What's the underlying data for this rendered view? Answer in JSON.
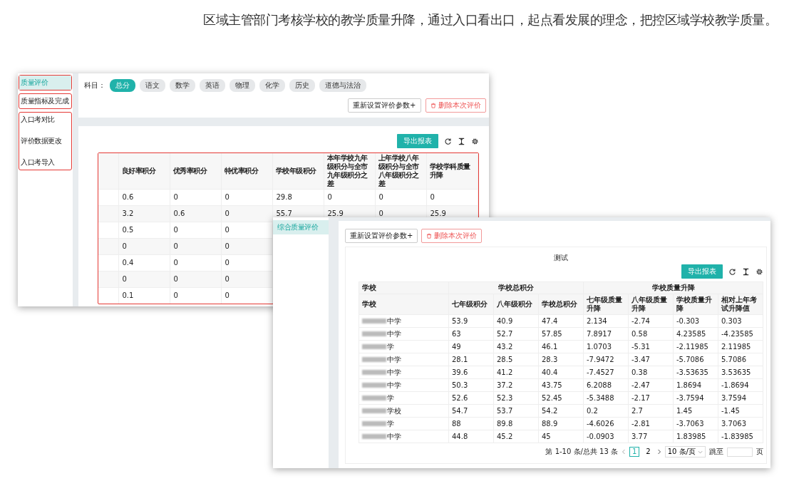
{
  "headline": "区域主管部门考核学校的教学质量升降，通过入口看出口，起点看发展的理念，把控区域学校教学质量。",
  "window_a": {
    "sidebar": {
      "groups": [
        {
          "outlined": true,
          "items": [
            {
              "label": "质量评价",
              "selected": true
            }
          ]
        },
        {
          "outlined": true,
          "items": [
            {
              "label": "质量指标及完成",
              "selected": false
            }
          ]
        },
        {
          "outlined": true,
          "items": [
            {
              "label": "入口考对比",
              "selected": false
            },
            {
              "label": "评价数据更改",
              "selected": false
            },
            {
              "label": "入口考导入",
              "selected": false
            }
          ]
        }
      ]
    },
    "subject_label": "科目：",
    "subjects": [
      {
        "label": "总分",
        "selected": true
      },
      {
        "label": "语文",
        "selected": false
      },
      {
        "label": "数学",
        "selected": false
      },
      {
        "label": "英语",
        "selected": false
      },
      {
        "label": "物理",
        "selected": false
      },
      {
        "label": "化学",
        "selected": false
      },
      {
        "label": "历史",
        "selected": false
      },
      {
        "label": "道德与法治",
        "selected": false
      }
    ],
    "buttons": [
      {
        "kind": "default",
        "label": "重新设置评价参数+"
      },
      {
        "kind": "danger",
        "label": "删除本次评价"
      }
    ],
    "export_button": "导出报表",
    "table": {
      "outlined": true,
      "columns": [
        "良好率积分",
        "优秀率积分",
        "特优率积分",
        "学校年级积分",
        "本年学校九年级积分与全市九年级积分之差",
        "上年学校八年级积分与全市八年级积分之差",
        "学校学科质量升降"
      ],
      "rows": [
        {
          "cells": [
            "0.6",
            "0",
            "0",
            "29.8",
            "0",
            "0",
            "0"
          ]
        },
        {
          "cells": [
            "3.2",
            "0.6",
            "0",
            "55.7",
            "25.9",
            "0",
            "25.9"
          ]
        },
        {
          "cells": [
            "0.5",
            "0",
            "0"
          ]
        },
        {
          "cells": [
            "0",
            "0",
            "0"
          ]
        },
        {
          "cells": [
            "0.4",
            "0",
            "0"
          ]
        },
        {
          "cells": [
            "0",
            "0",
            "0"
          ]
        },
        {
          "cells": [
            "0.1",
            "0",
            "0"
          ]
        }
      ]
    }
  },
  "window_b": {
    "sidebar": {
      "items": [
        {
          "label": "综合质量评价",
          "selected": true
        }
      ]
    },
    "buttons": [
      {
        "kind": "default",
        "label": "重新设置评价参数+"
      },
      {
        "kind": "danger",
        "label": "删除本次评价"
      }
    ],
    "title": "测试",
    "export_button": "导出报表",
    "table": {
      "header_groups": [
        {
          "label": "学校",
          "columns": [
            "学校"
          ]
        },
        {
          "label": "学校总积分",
          "columns": [
            "七年级积分",
            "八年级积分",
            "学校总积分"
          ]
        },
        {
          "label": "学校质量升降",
          "columns": [
            "七年级质量升降",
            "八年级质量升降",
            "学校质量升降",
            "相对上年考试升降值"
          ]
        }
      ],
      "rows": [
        {
          "school": "中学",
          "cells": [
            "53.9",
            "40.9",
            "47.4",
            "2.134",
            "-2.74",
            "-0.303",
            "0.303"
          ]
        },
        {
          "school": "中学",
          "cells": [
            "63",
            "52.7",
            "57.85",
            "7.8917",
            "0.58",
            "4.23585",
            "-4.23585"
          ]
        },
        {
          "school": "学",
          "cells": [
            "49",
            "43.2",
            "46.1",
            "1.0703",
            "-5.31",
            "-2.11985",
            "2.11985"
          ]
        },
        {
          "school": "中学",
          "cells": [
            "28.1",
            "28.5",
            "28.3",
            "-7.9472",
            "-3.47",
            "-5.7086",
            "5.7086"
          ]
        },
        {
          "school": "中学",
          "cells": [
            "39.6",
            "41.2",
            "40.4",
            "-7.4527",
            "0.38",
            "-3.53635",
            "3.53635"
          ]
        },
        {
          "school": "中学",
          "cells": [
            "50.3",
            "37.2",
            "43.75",
            "6.2088",
            "-2.47",
            "1.8694",
            "-1.8694"
          ]
        },
        {
          "school": "学",
          "cells": [
            "52.6",
            "52.3",
            "52.45",
            "-5.3488",
            "-2.17",
            "-3.7594",
            "3.7594"
          ]
        },
        {
          "school": "学校",
          "cells": [
            "54.7",
            "53.7",
            "54.2",
            "0.2",
            "2.7",
            "1.45",
            "-1.45"
          ]
        },
        {
          "school": "学",
          "cells": [
            "88",
            "89.8",
            "88.9",
            "-4.6026",
            "-2.81",
            "-3.7063",
            "3.7063"
          ]
        },
        {
          "school": "中学",
          "cells": [
            "44.8",
            "45.2",
            "45",
            "-0.0903",
            "3.77",
            "1.83985",
            "-1.83985"
          ]
        }
      ]
    },
    "pagination": {
      "summary": "第 1-10 条/总共 13 条",
      "pages": [
        {
          "label": "1",
          "selected": true
        },
        {
          "label": "2",
          "selected": false
        }
      ],
      "page_size": "10 条/页",
      "jump_label": "跳至",
      "jump_suffix": "页"
    }
  }
}
